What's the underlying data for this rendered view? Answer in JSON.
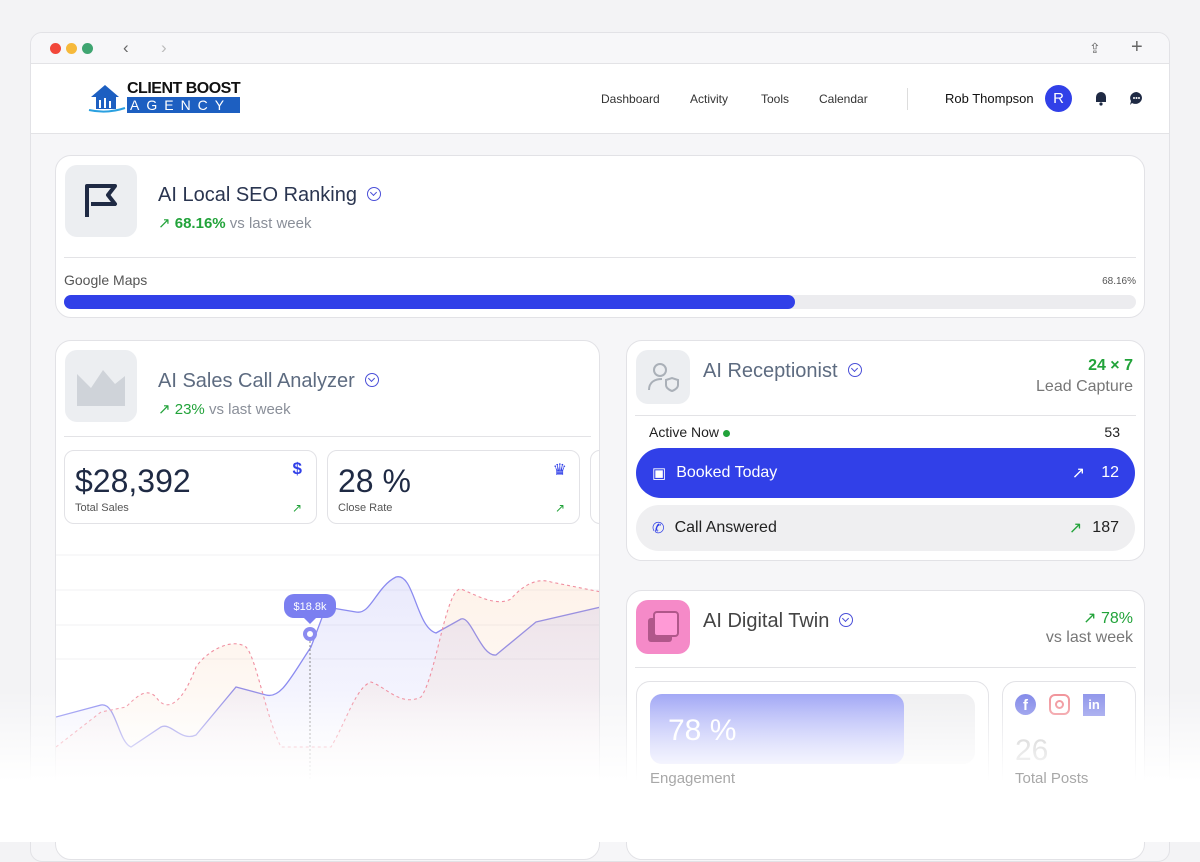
{
  "browser": {
    "back_icon": "chevron-left-icon",
    "forward_icon": "chevron-right-icon",
    "share_icon": "share-icon",
    "new_tab_icon": "plus-icon"
  },
  "header": {
    "logo_line1": "CLIENT BOOST",
    "logo_line2": "AGENCY",
    "nav": [
      "Dashboard",
      "Activity",
      "Tools",
      "Calendar"
    ],
    "user_name": "Rob Thompson",
    "avatar_letter": "R"
  },
  "seo": {
    "title": "AI Local SEO Ranking",
    "change": "68.16%",
    "change_suffix": "vs last week",
    "bar_label": "Google Maps",
    "bar_value_text": "68.16%",
    "bar_value": 68.16
  },
  "sales": {
    "title": "AI Sales Call Analyzer",
    "change": "23%",
    "change_suffix": "vs last week",
    "total_sales": "$28,392",
    "total_sales_label": "Total Sales",
    "close_rate": "28 %",
    "close_rate_label": "Close Rate",
    "tooltip": "$18.8k"
  },
  "receptionist": {
    "title": "AI Receptionist",
    "availability": "24 × 7",
    "availability_label": "Lead Capture",
    "active_label": "Active Now",
    "active_count": "53",
    "booked_label": "Booked Today",
    "booked_count": "12",
    "answered_label": "Call Answered",
    "answered_count": "187"
  },
  "twin": {
    "title": "AI Digital Twin",
    "change": "78%",
    "change_suffix": "vs last week",
    "engagement_text": "78 %",
    "engagement_value": 78,
    "engagement_label": "Engagement",
    "total_posts": "26",
    "total_posts_label": "Total Posts"
  },
  "colors": {
    "accent": "#3140e8",
    "green": "#22a33a",
    "purple_line": "#8b8bf0",
    "pink_dash": "#f08fa0"
  }
}
